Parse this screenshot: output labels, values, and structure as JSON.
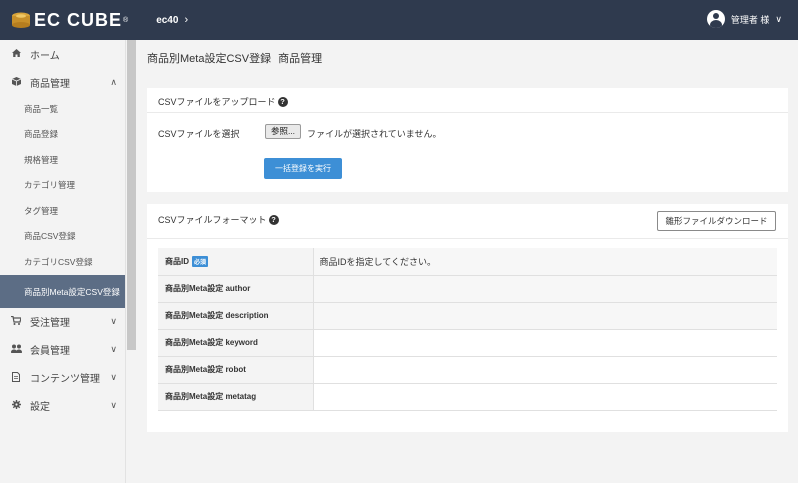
{
  "header": {
    "logo_text": "EC CUBE",
    "logo_reg": "®",
    "shop_name": "ec40",
    "shop_chevron": "›",
    "user_name": "管理者 様",
    "user_chevron": "∨"
  },
  "sidebar": {
    "items": [
      {
        "label": "ホーム",
        "icon": "home-icon"
      },
      {
        "label": "商品管理",
        "icon": "box-icon",
        "chevron": "∧"
      }
    ],
    "subitems": [
      {
        "label": "商品一覧"
      },
      {
        "label": "商品登録"
      },
      {
        "label": "規格管理"
      },
      {
        "label": "カテゴリ管理"
      },
      {
        "label": "タグ管理"
      },
      {
        "label": "商品CSV登録"
      },
      {
        "label": "カテゴリCSV登録"
      },
      {
        "label": "商品別Meta設定CSV登録"
      }
    ],
    "bottom_items": [
      {
        "label": "受注管理",
        "icon": "cart-icon",
        "chevron": "∨"
      },
      {
        "label": "会員管理",
        "icon": "users-icon",
        "chevron": "∨"
      },
      {
        "label": "コンテンツ管理",
        "icon": "document-icon",
        "chevron": "∨"
      },
      {
        "label": "設定",
        "icon": "gear-icon",
        "chevron": "∨"
      }
    ]
  },
  "page": {
    "title": "商品別Meta設定CSV登録",
    "separator": " ",
    "subtitle": "商品管理"
  },
  "upload_card": {
    "heading": "CSVファイルをアップロード",
    "help": "?",
    "file_label": "CSVファイルを選択",
    "browse_button": "参照...",
    "file_status": "ファイルが選択されていません。",
    "submit_button": "一括登録を実行"
  },
  "format_card": {
    "heading": "CSVファイルフォーマット",
    "help": "?",
    "download_button": "雛形ファイルダウンロード",
    "required_badge": "必須",
    "rows": [
      {
        "field": "商品ID",
        "desc": "商品IDを指定してください。"
      },
      {
        "field": "商品別Meta設定 author",
        "desc": ""
      },
      {
        "field": "商品別Meta設定 description",
        "desc": ""
      },
      {
        "field": "商品別Meta設定 keyword",
        "desc": ""
      },
      {
        "field": "商品別Meta設定 robot",
        "desc": ""
      },
      {
        "field": "商品別Meta設定 metatag",
        "desc": ""
      }
    ]
  },
  "colors": {
    "header_bg": "#2f3a4e",
    "sidebar_active_bg": "#5c6d85",
    "primary_button": "#3d8fd6"
  }
}
